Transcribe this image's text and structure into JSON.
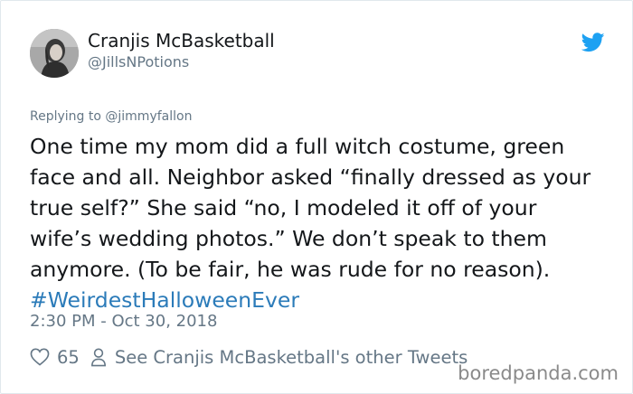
{
  "user": {
    "display_name": "Cranjis McBasketball",
    "handle": "@JillsNPotions"
  },
  "reply": {
    "prefix": "Replying to ",
    "mention": "@jimmyfallon"
  },
  "tweet": {
    "lines": [
      "One time my mom did a full witch costume, green",
      "face and all. Neighbor asked “finally dressed as your",
      "true self?” She said “no, I modeled it off of your",
      "wife’s wedding photos.” We don’t speak to them",
      "anymore. (To be fair, he was rude for no reason)."
    ],
    "hashtag": "#WeirdestHalloweenEver"
  },
  "timestamp": "2:30 PM - Oct 30, 2018",
  "footer": {
    "likes": "65",
    "other_tweets": "See Cranjis McBasketball's other Tweets"
  },
  "watermark": "boredpanda.com",
  "colors": {
    "twitter_blue": "#1da1f2",
    "hashtag": "#2b7bb9",
    "secondary_text": "#657786",
    "primary_text": "#14171a",
    "border": "#e1e8ed"
  },
  "icons": {
    "brand": "twitter-bird-icon",
    "like": "heart-icon",
    "profile": "person-icon"
  }
}
